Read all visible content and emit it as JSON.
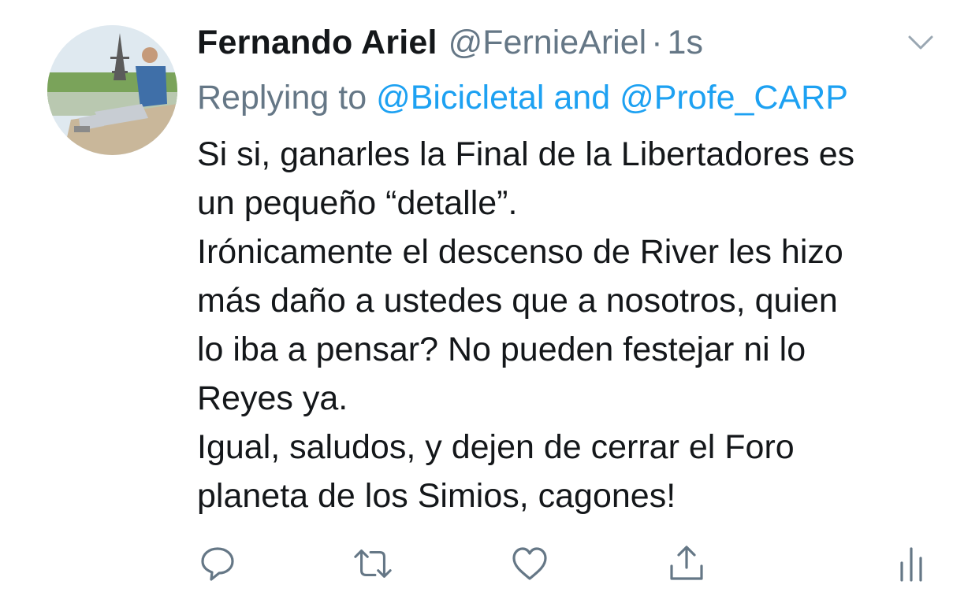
{
  "tweet": {
    "author_name": "Fernando Ariel",
    "author_handle": "@FernieAriel",
    "separator": "·",
    "timestamp": "1s",
    "reply_prefix": "Replying to",
    "reply_mention_1": "@Bicicletal",
    "reply_and": "and",
    "reply_mention_2": "@Profe_CARP",
    "body_lines": [
      "Si si, ganarles la Final de la Libertadores es",
      "un pequeño “detalle”.",
      "Irónicamente el descenso de River les hizo",
      "más daño a ustedes que a nosotros, quien",
      "lo iba a pensar? No pueden festejar ni lo",
      "Reyes ya.",
      "Igual, saludos, y dejen de cerrar el Foro",
      "planeta de los Simios, cagones!"
    ]
  },
  "icons": {
    "menu": "chevron-down-icon",
    "reply": "reply-icon",
    "retweet": "retweet-icon",
    "like": "heart-icon",
    "share": "share-icon",
    "analytics": "analytics-icon"
  },
  "colors": {
    "text": "#14171a",
    "secondary": "#657786",
    "link": "#1da1f2",
    "icon": "#657786"
  }
}
